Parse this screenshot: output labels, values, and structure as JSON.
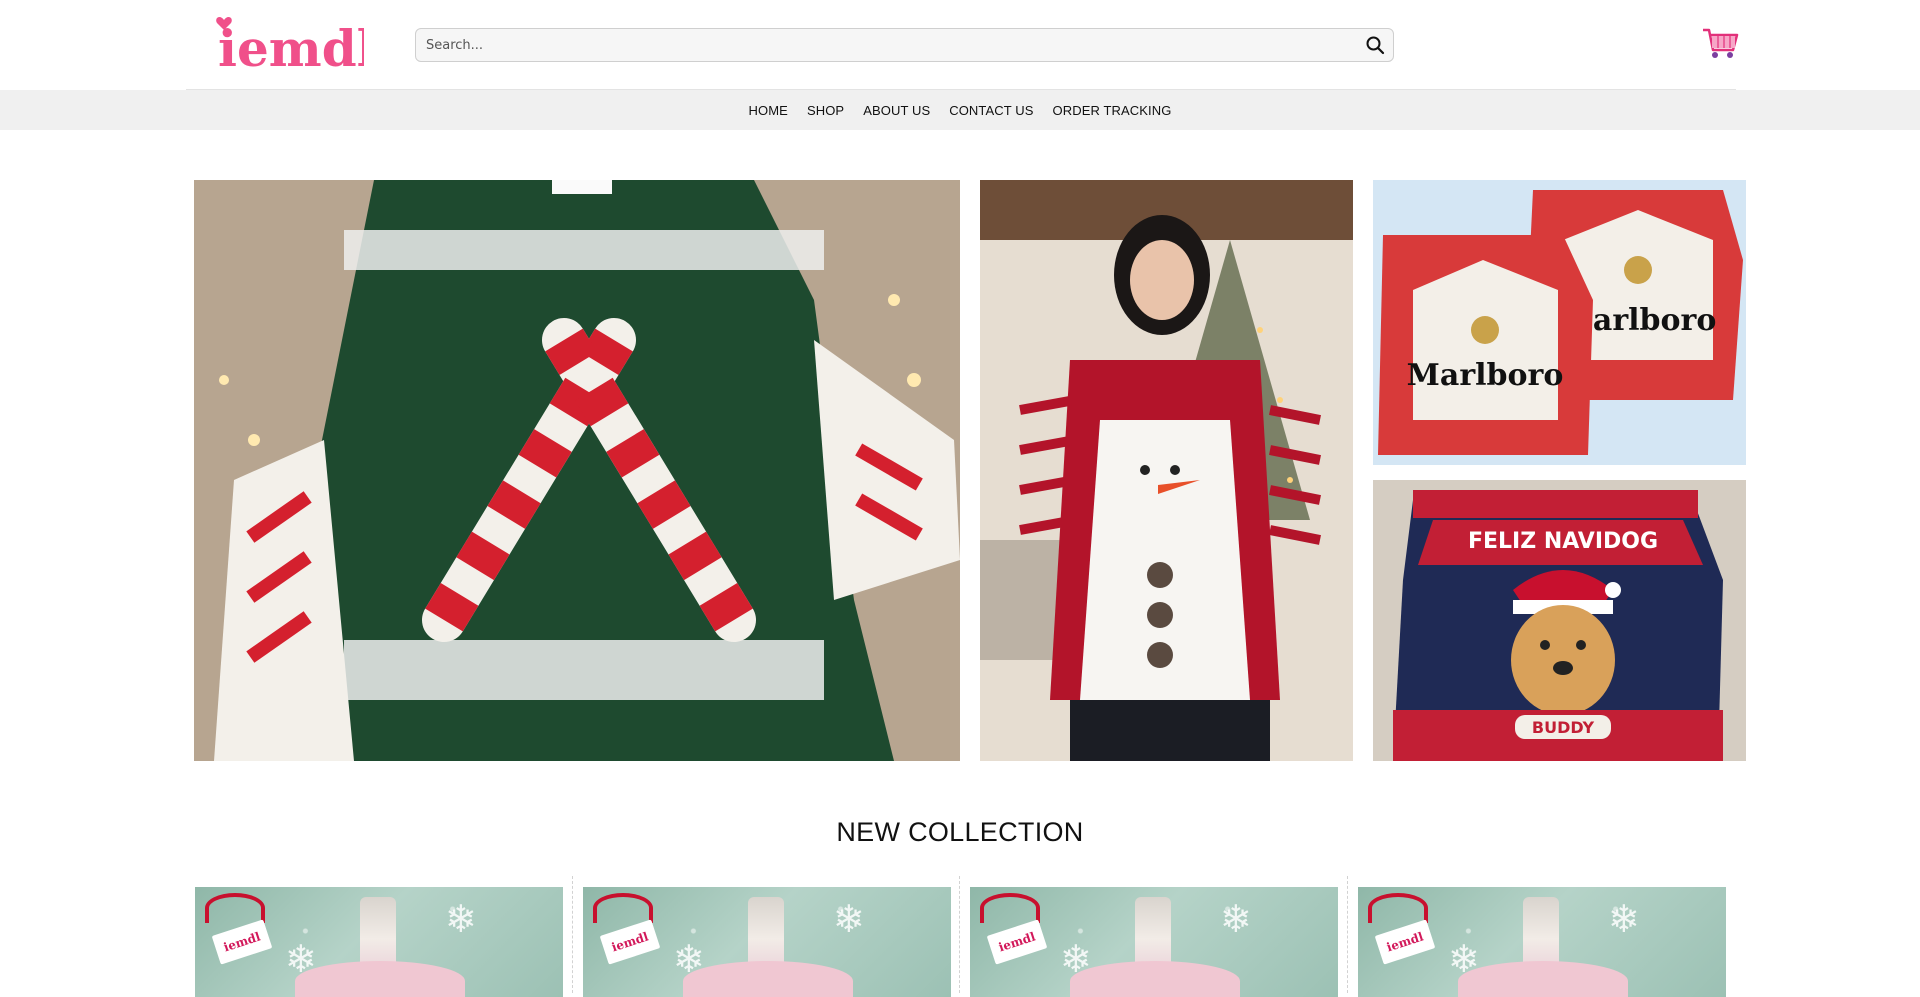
{
  "header": {
    "logo_text": "iemdl",
    "search_placeholder": "Search...",
    "search_icon": "search-icon",
    "cart_icon": "cart-icon",
    "brand_color": "#f0508a"
  },
  "nav": {
    "items": [
      "HOME",
      "SHOP",
      "ABOUT US",
      "CONTACT US",
      "ORDER TRACKING"
    ]
  },
  "banners": {
    "dog_sweater_text": "FELIZ NAVIDOG",
    "dog_name": "BUDDY",
    "marlboro_text_1": "Marlboro",
    "marlboro_text_2": "Marlboro"
  },
  "section": {
    "title": "NEW COLLECTION"
  },
  "products": {
    "tag_text": "iemdl",
    "count": 4
  }
}
